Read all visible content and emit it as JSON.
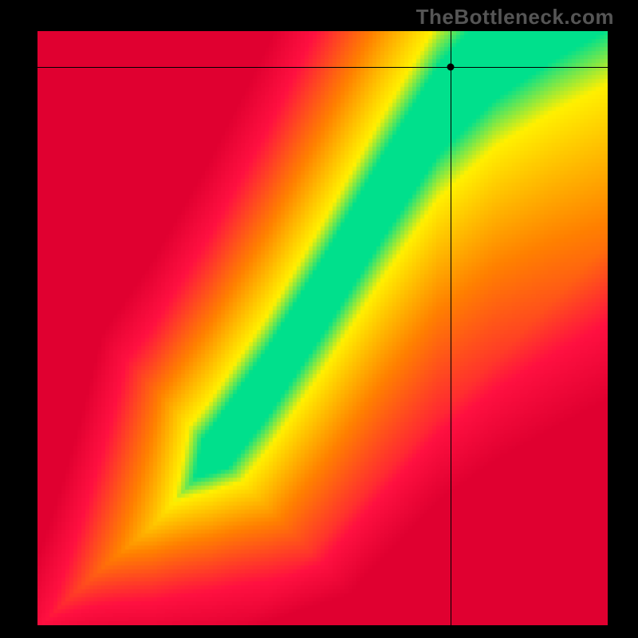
{
  "watermark": "TheBottleneck.com",
  "chart_data": {
    "type": "heatmap",
    "title": "",
    "xlabel": "",
    "ylabel": "",
    "xlim": [
      0,
      1
    ],
    "ylim": [
      0,
      1
    ],
    "grid": false,
    "marker": {
      "x": 0.725,
      "y": 0.94
    },
    "crosshair": {
      "x": 0.725,
      "y": 0.94
    },
    "colormap_note": "green-yellow-red diverging; green along optimal diagonal, red at extremes",
    "diagonal_curve": [
      [
        0.0,
        0.0
      ],
      [
        0.1,
        0.09
      ],
      [
        0.2,
        0.17
      ],
      [
        0.3,
        0.28
      ],
      [
        0.4,
        0.41
      ],
      [
        0.5,
        0.56
      ],
      [
        0.6,
        0.72
      ],
      [
        0.7,
        0.87
      ],
      [
        0.8,
        0.97
      ],
      [
        0.9,
        1.04
      ],
      [
        1.0,
        1.1
      ]
    ]
  },
  "colors": {
    "green": "#00e08c",
    "yellow": "#fff000",
    "orange": "#ff8000",
    "red": "#ff1040",
    "darkred": "#e00030"
  }
}
